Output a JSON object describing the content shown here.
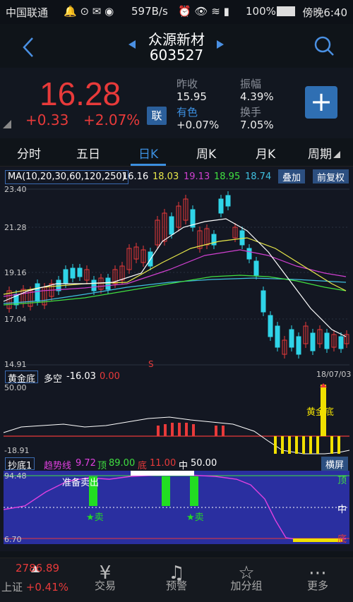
{
  "status_bar": {
    "carrier": "中国联通",
    "net_speed": "597B/s",
    "battery": "100%",
    "time": "傍晚6:40"
  },
  "header": {
    "stock_name": "众源新材",
    "stock_code": "603527"
  },
  "quote": {
    "price": "16.28",
    "change": "+0.33",
    "change_pct": "+2.07%",
    "lian_label": "联",
    "prev_close_label": "昨收",
    "prev_close": "15.95",
    "amplitude_label": "振幅",
    "amplitude": "4.39%",
    "float_label": "有色",
    "float_value": "+0.07%",
    "turnover_label": "换手",
    "turnover": "7.05%"
  },
  "tabs": [
    "分时",
    "五日",
    "日K",
    "周K",
    "月K",
    "周期"
  ],
  "active_tab": "日K",
  "ma_legend": {
    "label": "MA(10,20,30,60,120,250)",
    "v1": "16.16",
    "v2": "18.03",
    "v3": "19.13",
    "v4": "18.95",
    "v5": "18.74"
  },
  "buttons": {
    "overlay": "叠加",
    "adjust": "前复权",
    "landscape": "横屏"
  },
  "main_axis": {
    "y_ticks": [
      "23.40",
      "21.28",
      "19.16",
      "17.04",
      "14.91"
    ],
    "date": "18/07/03",
    "s_marker": "S"
  },
  "sub1": {
    "title": "黄金底",
    "label": "多空",
    "value": "-16.03",
    "value2": "0.00",
    "y_top": "50.00",
    "y_bottom": "-18.91",
    "annotation": "黄金底"
  },
  "sub2": {
    "title": "抄底1",
    "trend_label": "趋势线",
    "trend_value": "9.72",
    "top_label": "顶",
    "top_value": "89.00",
    "bottom_label": "底",
    "bottom_value": "11.00",
    "mid_label": "中",
    "mid_value": "50.00",
    "y_top": "94.48",
    "y_bottom": "6.70",
    "sell_note": "准备卖出",
    "sell_tag": "卖",
    "right_top": "顶",
    "right_mid": "中",
    "right_bottom": "底"
  },
  "bottom_nav": {
    "index_value": "2786.89",
    "index_name": "上证",
    "index_change": "+0.41%",
    "items": [
      "交易",
      "预警",
      "加分组",
      "更多"
    ]
  },
  "colors": {
    "up": "#e83a3a",
    "down": "#2fd4e8",
    "accent": "#3c8fe0",
    "ma10": "#ffffff",
    "ma20": "#e8e84a",
    "ma30": "#d040d0",
    "ma60": "#40e040",
    "ma120": "#40c0e0"
  }
}
